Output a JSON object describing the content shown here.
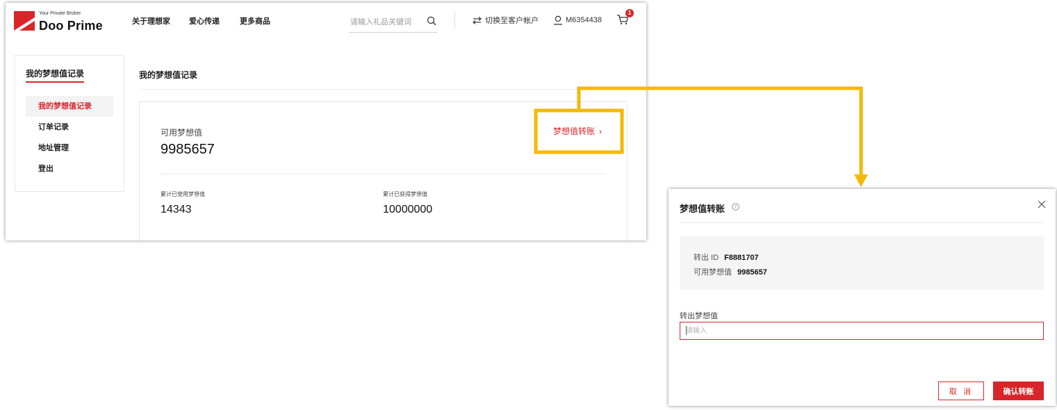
{
  "colors": {
    "brand_red": "#d9252a",
    "callout_yellow": "#f5b800",
    "panel_gray": "#f5f5f5"
  },
  "header": {
    "logo": {
      "tagline": "Your Private Broker",
      "name": "Doo Prime",
      "icon": "doo-prime-logo-mark"
    },
    "nav": [
      "关于理想家",
      "爱心传递",
      "更多商品"
    ],
    "search": {
      "placeholder": "请输入礼品关键词",
      "icon": "search-icon"
    },
    "switch_account_label": "切换至客户帐户",
    "user_id": "M6354438",
    "cart_count": "1"
  },
  "sidebar": {
    "title": "我的梦想值记录",
    "items": [
      {
        "label": "我的梦想值记录",
        "active": true
      },
      {
        "label": "订单记录",
        "active": false
      },
      {
        "label": "地址管理",
        "active": false
      },
      {
        "label": "登出",
        "active": false
      }
    ]
  },
  "main": {
    "title": "我的梦想值记录",
    "available_label": "可用梦想值",
    "available_value": "9985657",
    "transfer_link": "梦想值转账",
    "stats": [
      {
        "label": "累计已使用梦想值",
        "value": "14343"
      },
      {
        "label": "累计已获得梦想值",
        "value": "10000000"
      }
    ]
  },
  "modal": {
    "title": "梦想值转账",
    "info": {
      "transfer_id_label": "转出 ID",
      "transfer_id_value": "F8881707",
      "available_label": "可用梦想值",
      "available_value": "9985657"
    },
    "field_label": "转出梦想值",
    "field_placeholder": "请输入",
    "field_value": "",
    "cancel_label": "取 消",
    "confirm_label": "确认转账"
  }
}
